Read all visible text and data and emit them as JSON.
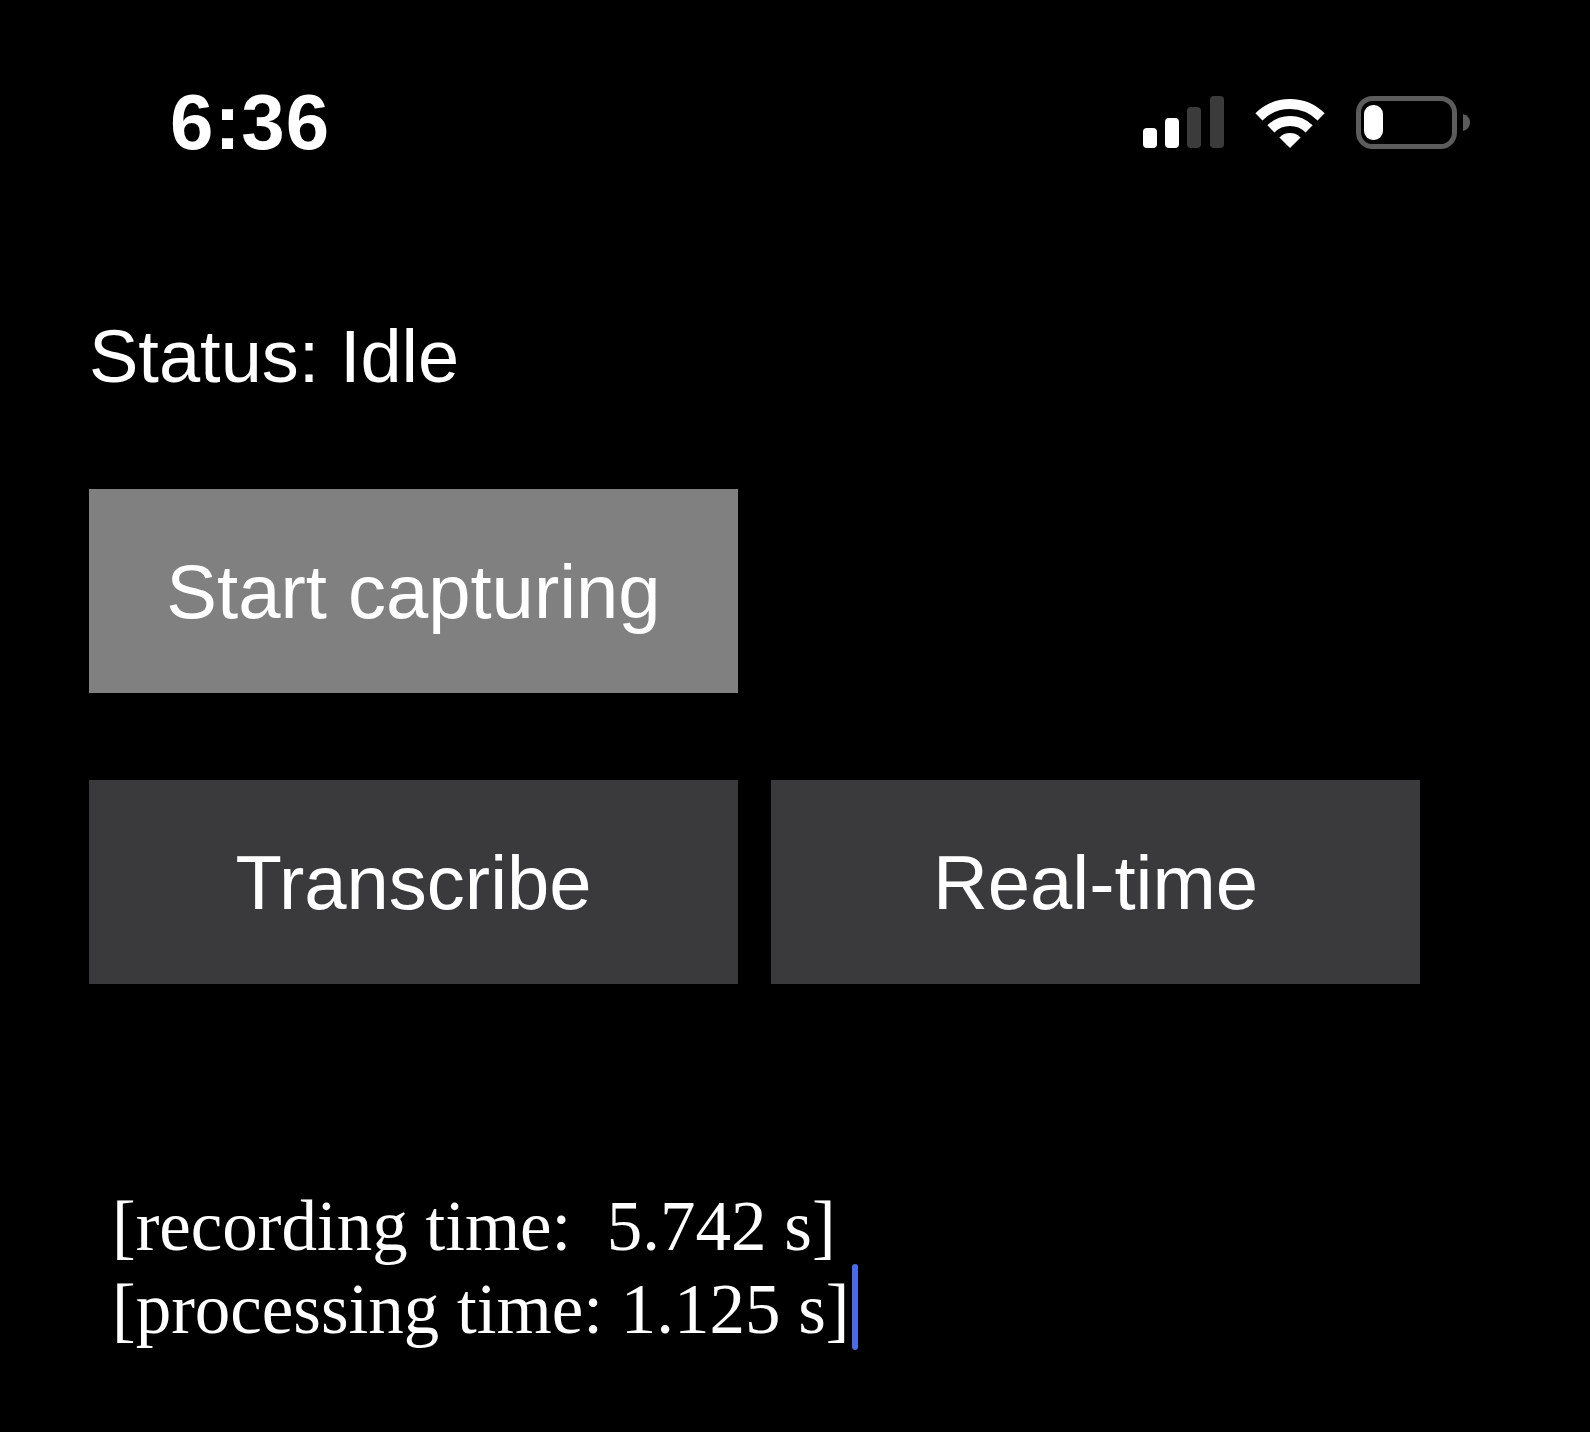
{
  "status_bar": {
    "time": "6:36"
  },
  "status": {
    "text": "Status: Idle"
  },
  "button_rows": [
    {
      "buttons": [
        {
          "label": "Start capturing",
          "kind": "primary"
        }
      ]
    },
    {
      "buttons": [
        {
          "label": "Transcribe",
          "kind": "secondary"
        },
        {
          "label": "Real-time",
          "kind": "secondary"
        }
      ]
    }
  ],
  "output": {
    "lines": [
      "[recording time:  5.742 s]",
      "[processing time: 1.125 s]"
    ],
    "focused": true
  }
}
